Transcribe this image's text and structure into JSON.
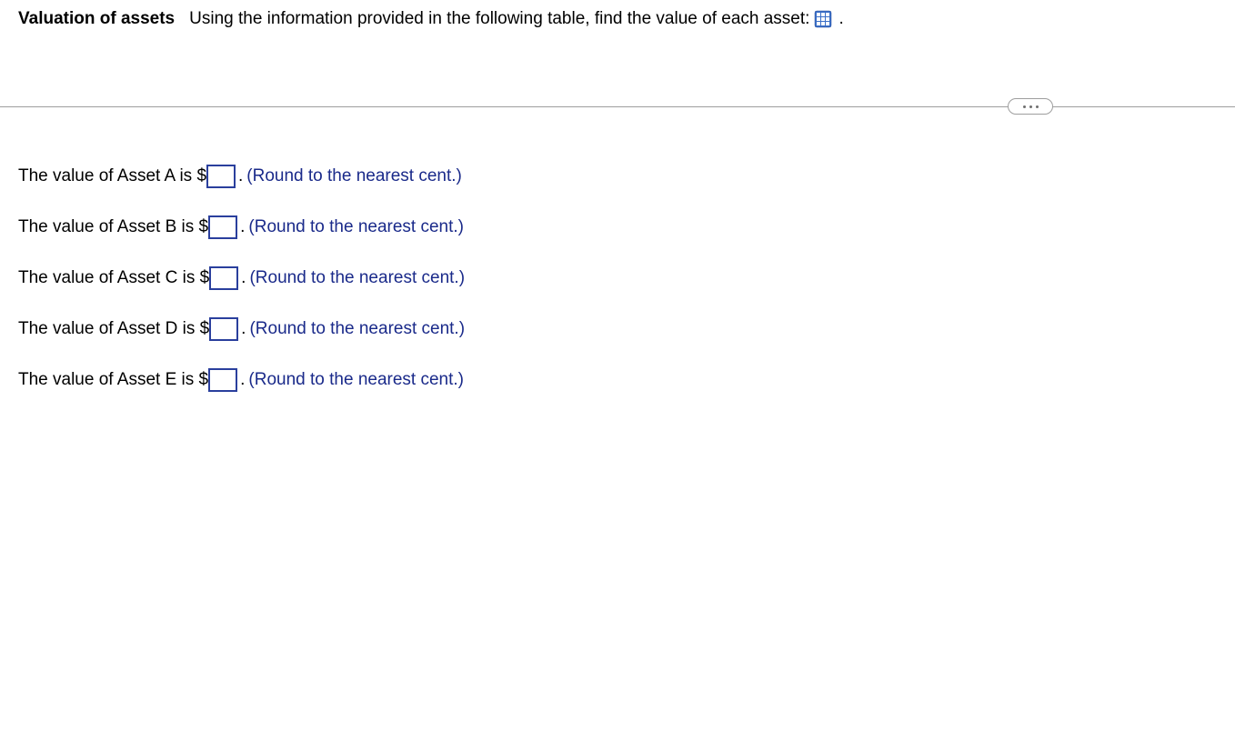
{
  "header": {
    "bold_title": "Valuation of assets",
    "description": "Using the information provided in the following table, find the value of each asset:",
    "trailing_period": "."
  },
  "items": [
    {
      "prefix": "The value of Asset A is $",
      "value": "",
      "period": ".",
      "hint": "(Round to the nearest cent.)"
    },
    {
      "prefix": "The value of Asset B is $",
      "value": "",
      "period": ".",
      "hint": "(Round to the nearest cent.)"
    },
    {
      "prefix": "The value of Asset C is $",
      "value": "",
      "period": ".",
      "hint": "(Round to the nearest cent.)"
    },
    {
      "prefix": "The value of Asset D is $",
      "value": "",
      "period": ".",
      "hint": "(Round to the nearest cent.)"
    },
    {
      "prefix": "The value of Asset E is $",
      "value": "",
      "period": ".",
      "hint": "(Round to the nearest cent.)"
    }
  ]
}
